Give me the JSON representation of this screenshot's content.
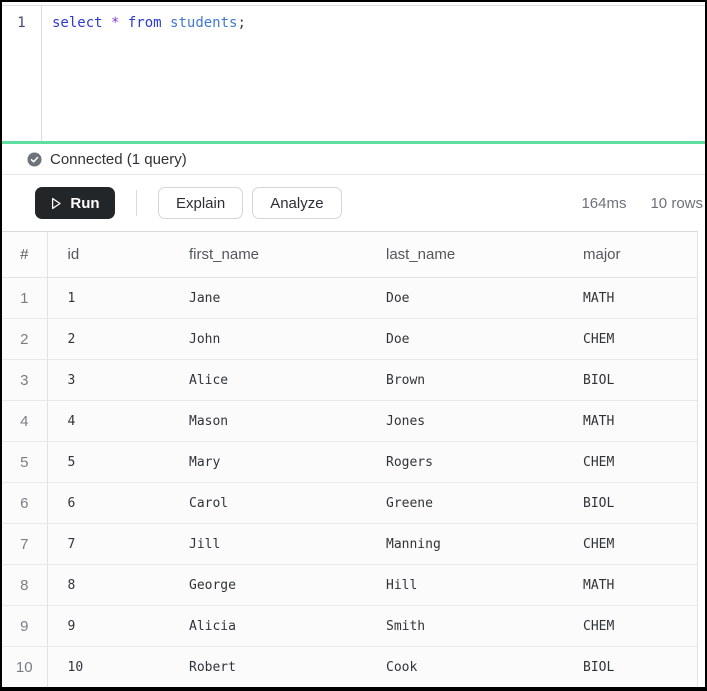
{
  "colors": {
    "accent_green": "#5ddfa1",
    "run_bg": "#232629",
    "keyword": "#2c39d2",
    "star_op": "#7b3fd4",
    "identifier": "#4078d0"
  },
  "editor": {
    "line_number": "1",
    "tokens": {
      "kw_select": "select ",
      "star": "* ",
      "kw_from": "from ",
      "identifier": "students",
      "semicolon": ";"
    }
  },
  "status": {
    "label": "Connected (1 query)",
    "icon": "check-circle-icon"
  },
  "toolbar": {
    "run_label": "Run",
    "explain_label": "Explain",
    "analyze_label": "Analyze",
    "duration": "164ms",
    "row_count": "10 rows"
  },
  "table": {
    "columns": [
      "#",
      "id",
      "first_name",
      "last_name",
      "major"
    ],
    "rows": [
      [
        "1",
        "1",
        "Jane",
        "Doe",
        "MATH"
      ],
      [
        "2",
        "2",
        "John",
        "Doe",
        "CHEM"
      ],
      [
        "3",
        "3",
        "Alice",
        "Brown",
        "BIOL"
      ],
      [
        "4",
        "4",
        "Mason",
        "Jones",
        "MATH"
      ],
      [
        "5",
        "5",
        "Mary",
        "Rogers",
        "CHEM"
      ],
      [
        "6",
        "6",
        "Carol",
        "Greene",
        "BIOL"
      ],
      [
        "7",
        "7",
        "Jill",
        "Manning",
        "CHEM"
      ],
      [
        "8",
        "8",
        "George",
        "Hill",
        "MATH"
      ],
      [
        "9",
        "9",
        "Alicia",
        "Smith",
        "CHEM"
      ],
      [
        "10",
        "10",
        "Robert",
        "Cook",
        "BIOL"
      ]
    ]
  }
}
